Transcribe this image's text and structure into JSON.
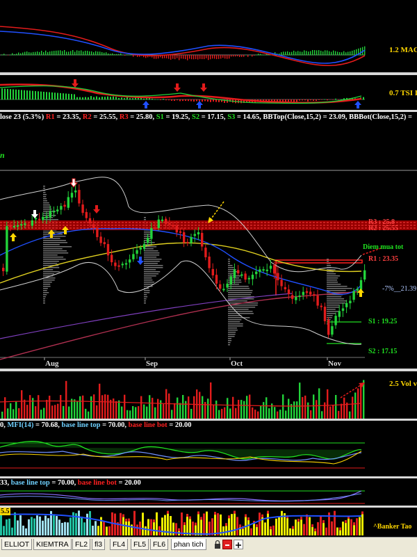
{
  "colors": {
    "up": "#22d33a",
    "down": "#e21c1c",
    "gold": "#ffd700",
    "bg": "#000000"
  },
  "panes": {
    "macd": {
      "label": "1.2 MAC"
    },
    "tsi": {
      "label": "0.7 TSI I"
    },
    "volume": {
      "label": "2.5 Vol v"
    },
    "banker": {
      "label": "^Banker Tao"
    }
  },
  "info_bar": {
    "segments": [
      {
        "text": "lose 23 (5.3%) ",
        "color": "white"
      },
      {
        "text": "R1",
        "color": "red"
      },
      {
        "text": " = 23.35, ",
        "color": "white"
      },
      {
        "text": "R2",
        "color": "red"
      },
      {
        "text": " = 25.55, ",
        "color": "white"
      },
      {
        "text": "R3",
        "color": "red"
      },
      {
        "text": " = 25.80, ",
        "color": "white"
      },
      {
        "text": "S1",
        "color": "green"
      },
      {
        "text": " = 19.25, ",
        "color": "white"
      },
      {
        "text": "S2",
        "color": "green"
      },
      {
        "text": " = 17.15, ",
        "color": "white"
      },
      {
        "text": "S3",
        "color": "green"
      },
      {
        "text": " = 14.65, BBTop(Close,15,2) = 23.09, BBBot(Close,15,2) =",
        "color": "white"
      }
    ]
  },
  "price": {
    "corner_letter": "n",
    "annotations": {
      "r1": "R1 : 23.35",
      "r2": "R2 : 25.55",
      "r3": "R3 : 25.8",
      "s1": "S1 : 19.25",
      "s2": "S2 : 17.15",
      "signal": "Diem mua tot",
      "pct": "-7%__21.39"
    },
    "months": [
      "Aug",
      "Sep",
      "Oct",
      "Nov"
    ]
  },
  "mfi": {
    "segments": [
      {
        "text": "0, ",
        "color": "white"
      },
      {
        "text": "MFI(14)",
        "color": "cyan"
      },
      {
        "text": " = 70.68, ",
        "color": "white"
      },
      {
        "text": "base line top",
        "color": "cyan"
      },
      {
        "text": " = 70.00, ",
        "color": "white"
      },
      {
        "text": "base line bot",
        "color": "red"
      },
      {
        "text": " = 20.00",
        "color": "white"
      }
    ]
  },
  "rsi": {
    "segments": [
      {
        "text": "33, ",
        "color": "white"
      },
      {
        "text": "base line top",
        "color": "cyan"
      },
      {
        "text": " = 70.00, ",
        "color": "white"
      },
      {
        "text": "base line bot",
        "color": "red"
      },
      {
        "text": " = 20.00",
        "color": "white"
      }
    ]
  },
  "banker_top_label": "5.5",
  "tabs": [
    "ELLIOT",
    "KIEMTRA",
    "FL2",
    "fl3",
    "FL4",
    "FL5",
    "FL6",
    "phan tich"
  ]
}
